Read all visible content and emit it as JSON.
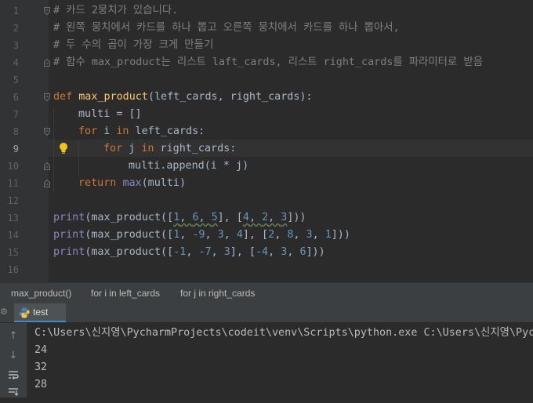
{
  "editor": {
    "line_numbers": [
      "1",
      "2",
      "3",
      "4",
      "5",
      "6",
      "7",
      "8",
      "9",
      "10",
      "11",
      "12",
      "13",
      "14",
      "15",
      "16"
    ],
    "comments": [
      "# 카드 2뭉치가 있습니다.",
      "# 왼쪽 뭉치에서 카드를 하나 뽑고 오른쪽 뭉치에서 카드를 하나 뽑아서,",
      "# 두 수의 곱이 가장 크게 만들기",
      "# 함수 max_product는 리스트 laft_cards, 리스트 right_cards를 파라미터로 받음"
    ],
    "code": {
      "def_kw": "def",
      "func_name": "max_product",
      "def_params": "(left_cards, right_cards):",
      "multi_line": "multi = []",
      "for_kw": "for",
      "i_var": " i ",
      "in_kw": "in",
      "for1_rest": " left_cards:",
      "j_var": " j ",
      "for2_rest": " right_cards:",
      "append_line": "multi.append(i * j)",
      "return_kw": "return",
      "max_fn": "max",
      "return_rest": "(multi)",
      "print_fn": "print",
      "calls": [
        {
          "open": "(max_product([",
          "a": [
            "1",
            "6",
            "5"
          ],
          "mid": "], [",
          "b": [
            "4",
            "2",
            "3"
          ],
          "close": "]))"
        },
        {
          "open": "(max_product([",
          "a": [
            "1",
            "-9",
            "3",
            "4"
          ],
          "mid": "], [",
          "b": [
            "2",
            "8",
            "3",
            "1"
          ],
          "close": "]))"
        },
        {
          "open": "(max_product([",
          "a": [
            "-1",
            "-7",
            "3"
          ],
          "mid": "], [",
          "b": [
            "-4",
            "3",
            "6"
          ],
          "close": "]))"
        }
      ]
    }
  },
  "breadcrumb": [
    "max_product()",
    "for i in left_cards",
    "for j in right_cards"
  ],
  "run": {
    "tab_label": "test",
    "command_line": "C:\\Users\\신지영\\PycharmProjects\\codeit\\venv\\Scripts\\python.exe C:\\Users\\신지영\\PycharmProjects\\codeit\\test.py",
    "outputs": [
      "24",
      "32",
      "28"
    ]
  },
  "icons": {
    "lightbulb": "lightbulb-icon",
    "python": "python-icon",
    "settings": "gear-icon",
    "up": "arrow-up-icon",
    "down": "arrow-down-icon",
    "wrap": "soft-wrap-icon",
    "scroll_end": "scroll-to-end-icon"
  },
  "colors": {
    "background": "#2b2b2b",
    "gutter": "#313335",
    "comment": "#808080",
    "keyword": "#cc7832",
    "function": "#ffc66d",
    "number": "#6897bb",
    "builtin": "#8888c6",
    "text": "#a9b7c6",
    "tab_accent": "#4a88c7"
  }
}
